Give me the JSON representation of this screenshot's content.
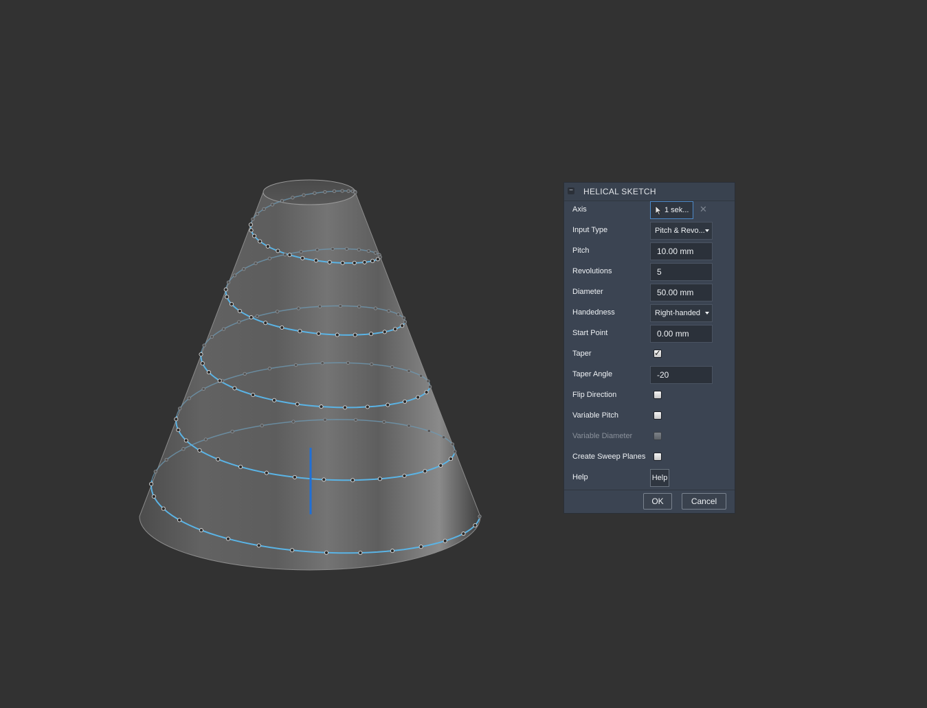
{
  "dialog": {
    "title": "HELICAL SKETCH",
    "collapse_icon": "minus-icon",
    "rows": {
      "axis": {
        "label": "Axis",
        "value": "1 sek...",
        "icon": "cursor-arrow-icon",
        "clear_icon": "close-x-icon"
      },
      "input_type": {
        "label": "Input Type",
        "value": "Pitch & Revo..."
      },
      "pitch": {
        "label": "Pitch",
        "value": "10.00 mm"
      },
      "revolutions": {
        "label": "Revolutions",
        "value": "5"
      },
      "diameter": {
        "label": "Diameter",
        "value": "50.00 mm"
      },
      "handedness": {
        "label": "Handedness",
        "value": "Right-handed"
      },
      "start_point": {
        "label": "Start Point",
        "value": "0.00 mm"
      },
      "taper": {
        "label": "Taper",
        "checked": true
      },
      "taper_angle": {
        "label": "Taper Angle",
        "value": "-20"
      },
      "flip_direction": {
        "label": "Flip Direction",
        "checked": false
      },
      "variable_pitch": {
        "label": "Variable Pitch",
        "checked": false
      },
      "variable_diameter": {
        "label": "Variable Diameter",
        "checked": false,
        "disabled": true
      },
      "create_sweep_planes": {
        "label": "Create Sweep Planes",
        "checked": false
      },
      "help": {
        "label": "Help",
        "button": "Help"
      }
    },
    "buttons": {
      "ok": "OK",
      "cancel": "Cancel"
    }
  },
  "colors": {
    "background": "#323232",
    "cone_body": "#5a5a5a",
    "helix_front": "#5ab4e6",
    "helix_back": "#6e9bb5",
    "axis_line": "#1f6fd6",
    "dialog_bg": "#3b4452"
  }
}
